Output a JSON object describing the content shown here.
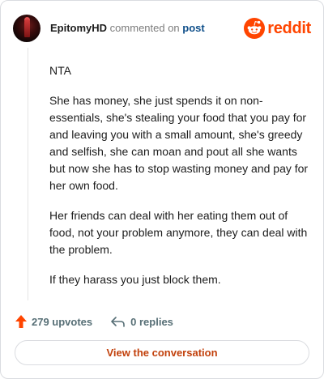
{
  "header": {
    "username": "EpitomyHD",
    "verb": " commented on ",
    "post_link": "post",
    "brand_name": "reddit"
  },
  "comment": {
    "paragraphs": [
      "NTA",
      "She has money, she just spends it on non-essentials, she's stealing your food that you pay for and leaving you with a small amount, she's greedy and selfish, she can moan and pout all she wants but now she has to stop wasting money and pay for her own food.",
      "Her friends can deal with her eating them out of food, not your problem anymore, they can deal with the problem.",
      "If they harass you just block them."
    ]
  },
  "actions": {
    "upvotes_label": "279 upvotes",
    "replies_label": "0 replies",
    "upvote_icon": "upvote-arrow-icon",
    "reply_icon": "reply-arrow-icon"
  },
  "cta": {
    "label": "View the conversation"
  },
  "colors": {
    "brand": "#ff4500",
    "link": "#0f4f8a",
    "muted": "#7c7c7c",
    "action_text": "#576f76",
    "cta_text": "#c2410c",
    "border": "#dadce0"
  }
}
